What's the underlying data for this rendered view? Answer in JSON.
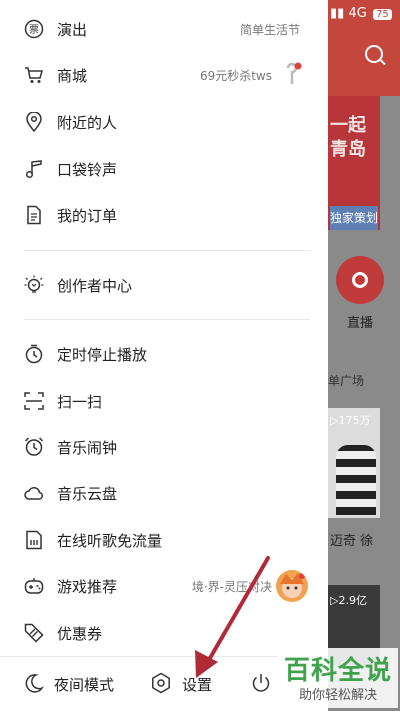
{
  "status_bar": {
    "network": "4G",
    "battery": "75"
  },
  "background": {
    "banner_text": "一起\n青岛",
    "banner_tag": "独家策划",
    "live_label": "直播",
    "playlist_label": "单广场",
    "card1_count": "▷175万",
    "card1_text": "迈奇 徐",
    "card2_count": "▷2.9亿"
  },
  "menu": [
    {
      "label": "演出",
      "icon": "ticket-icon",
      "extra": "简单生活节"
    },
    {
      "label": "商城",
      "icon": "cart-icon",
      "extra": "69元秒杀tws"
    },
    {
      "label": "附近的人",
      "icon": "location-pin-icon",
      "extra": ""
    },
    {
      "label": "口袋铃声",
      "icon": "music-note-icon",
      "extra": ""
    },
    {
      "label": "我的订单",
      "icon": "order-document-icon",
      "extra": ""
    },
    {
      "label": "创作者中心",
      "icon": "lightbulb-icon",
      "extra": ""
    },
    {
      "label": "定时停止播放",
      "icon": "timer-icon",
      "extra": ""
    },
    {
      "label": "扫一扫",
      "icon": "scan-icon",
      "extra": ""
    },
    {
      "label": "音乐闹钟",
      "icon": "alarm-clock-icon",
      "extra": ""
    },
    {
      "label": "音乐云盘",
      "icon": "cloud-icon",
      "extra": ""
    },
    {
      "label": "在线听歌免流量",
      "icon": "sim-card-icon",
      "extra": ""
    },
    {
      "label": "游戏推荐",
      "icon": "gamepad-icon",
      "extra": "境·界-灵压对决"
    },
    {
      "label": "优惠券",
      "icon": "coupon-icon",
      "extra": ""
    }
  ],
  "bottom_bar": {
    "night_mode": "夜间模式",
    "settings": "设置"
  },
  "watermark": {
    "title": "百科全说",
    "subtitle": "助你轻松解决"
  },
  "colors": {
    "accent_red": "#c4473e",
    "arrow": "#b02a37",
    "watermark_green": "#3fa34d"
  }
}
